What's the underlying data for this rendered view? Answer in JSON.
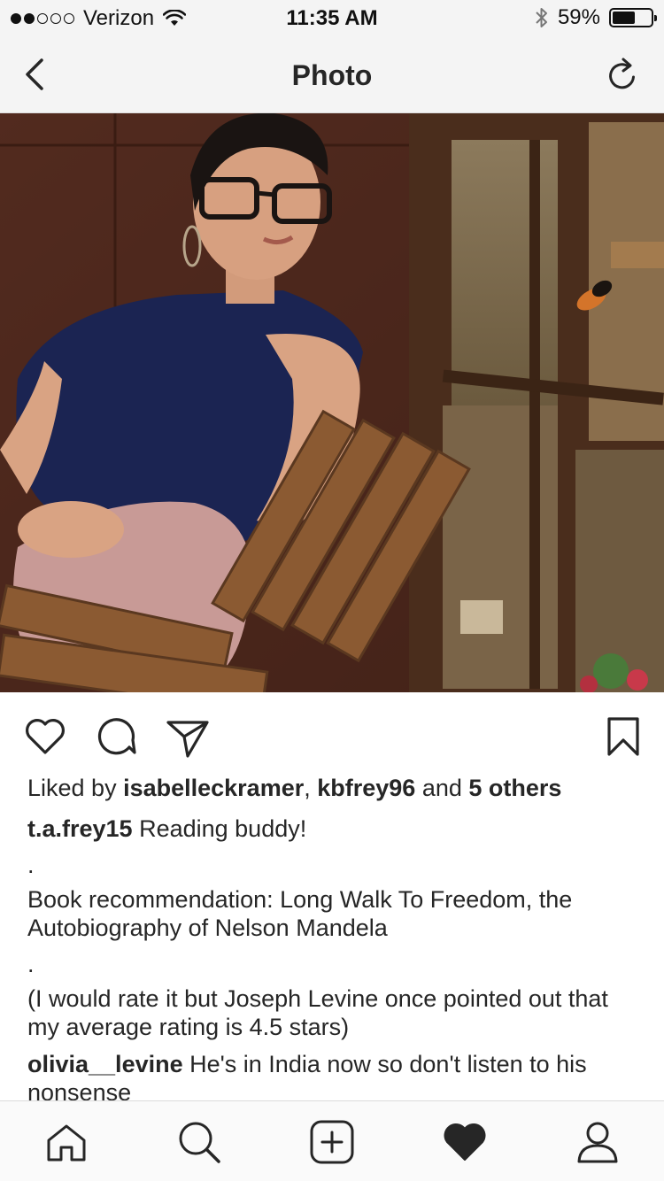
{
  "status_bar": {
    "carrier": "Verizon",
    "time": "11:35 AM",
    "battery_percent": "59%",
    "battery_level": 0.59,
    "signal_bars_filled": 2,
    "signal_bars_total": 5
  },
  "nav": {
    "title": "Photo",
    "back_icon": "chevron-left-icon",
    "refresh_icon": "refresh-icon"
  },
  "photo": {
    "alt": "Woman in glasses and navy top sitting on a wooden chair by a window with a butterfly"
  },
  "actions": {
    "like_icon": "heart-outline-icon",
    "comment_icon": "comment-icon",
    "share_icon": "send-icon",
    "save_icon": "bookmark-icon"
  },
  "likes": {
    "prefix": "Liked by ",
    "user1": "isabelleckramer",
    "sep": ", ",
    "user2": "kbfrey96",
    "and": " and ",
    "others": "5 others"
  },
  "caption": {
    "username": "t.a.frey15",
    "text": " Reading buddy!",
    "dot1": ".",
    "line2": "Book recommendation: Long Walk To Freedom, the Autobiography of Nelson Mandela",
    "dot2": ".",
    "line3": "(I would rate it but Joseph Levine once pointed out that my average rating is 4.5 stars)"
  },
  "comments": [
    {
      "username": "olivia__levine",
      "text": " He's in India now so don't listen to his nonsense"
    }
  ],
  "tab_bar": {
    "items": [
      "home-icon",
      "search-icon",
      "add-post-icon",
      "activity-heart-icon",
      "profile-icon"
    ],
    "active": "activity-heart-icon"
  }
}
